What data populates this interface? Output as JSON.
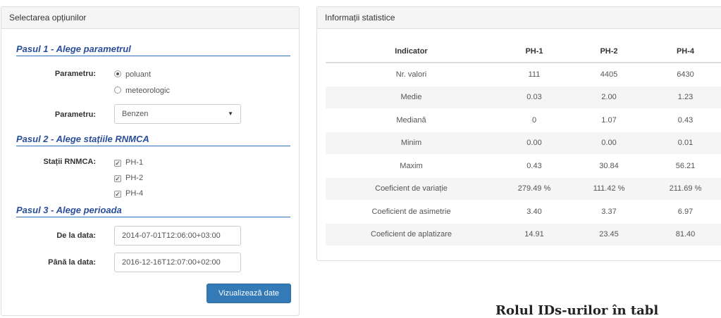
{
  "left_panel": {
    "heading": "Selectarea opțiunilor",
    "step1": {
      "title": "Pasul 1 - Alege parametrul",
      "param_label": "Parametru:",
      "radio_options": [
        "poluant",
        "meteorologic"
      ],
      "selected_radio": "poluant",
      "param2_label": "Parametru:",
      "select_value": "Benzen"
    },
    "step2": {
      "title": "Pasul 2 - Alege stațiile RNMCA",
      "stations_label": "Stații RNMCA:",
      "stations": [
        "PH-1",
        "PH-2",
        "PH-4"
      ],
      "stations_checked": [
        true,
        true,
        true
      ]
    },
    "step3": {
      "title": "Pasul 3 - Alege perioada",
      "from_label": "De la data:",
      "from_value": "2014-07-01T12:06:00+03:00",
      "to_label": "Până la data:",
      "to_value": "2016-12-16T12:07:00+02:00"
    },
    "button_label": "Vizualizează date"
  },
  "right_panel": {
    "heading": "Informații statistice",
    "columns": [
      "Indicator",
      "PH-1",
      "PH-2",
      "PH-4"
    ],
    "rows": [
      [
        "Nr. valori",
        "111",
        "4405",
        "6430"
      ],
      [
        "Medie",
        "0.03",
        "2.00",
        "1.23"
      ],
      [
        "Mediană",
        "0",
        "1.07",
        "0.43"
      ],
      [
        "Minim",
        "0.00",
        "0.00",
        "0.01"
      ],
      [
        "Maxim",
        "0.43",
        "30.84",
        "56.21"
      ],
      [
        "Coeficient de variație",
        "279.49 %",
        "111.42 %",
        "211.69 %"
      ],
      [
        "Coeficient de asimetrie",
        "3.40",
        "3.37",
        "6.97"
      ],
      [
        "Coeficient de aplatizare",
        "14.91",
        "23.45",
        "81.40"
      ]
    ]
  },
  "partial_text": "Rolul IDs-urilor în tabl",
  "colors": {
    "accent_blue": "#337ab7",
    "step_title": "#2a4d9b",
    "panel_heading_bg": "#f5f5f5"
  }
}
